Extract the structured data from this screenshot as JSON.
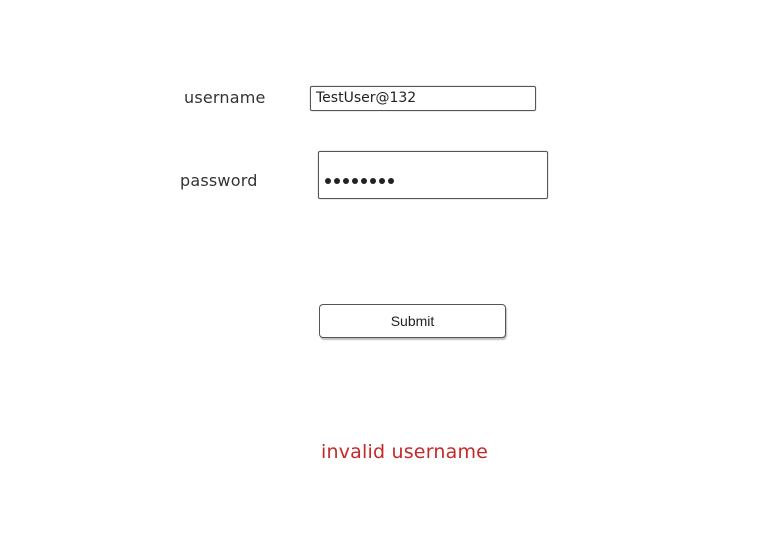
{
  "form": {
    "username": {
      "label": "username",
      "value": "TestUser@132"
    },
    "password": {
      "label": "password",
      "masked_value": "••••••••",
      "length": 8
    },
    "submit_label": "Submit",
    "error_message": "invalid username"
  },
  "colors": {
    "error": "#c62828",
    "text": "#333333",
    "border": "#555555"
  }
}
